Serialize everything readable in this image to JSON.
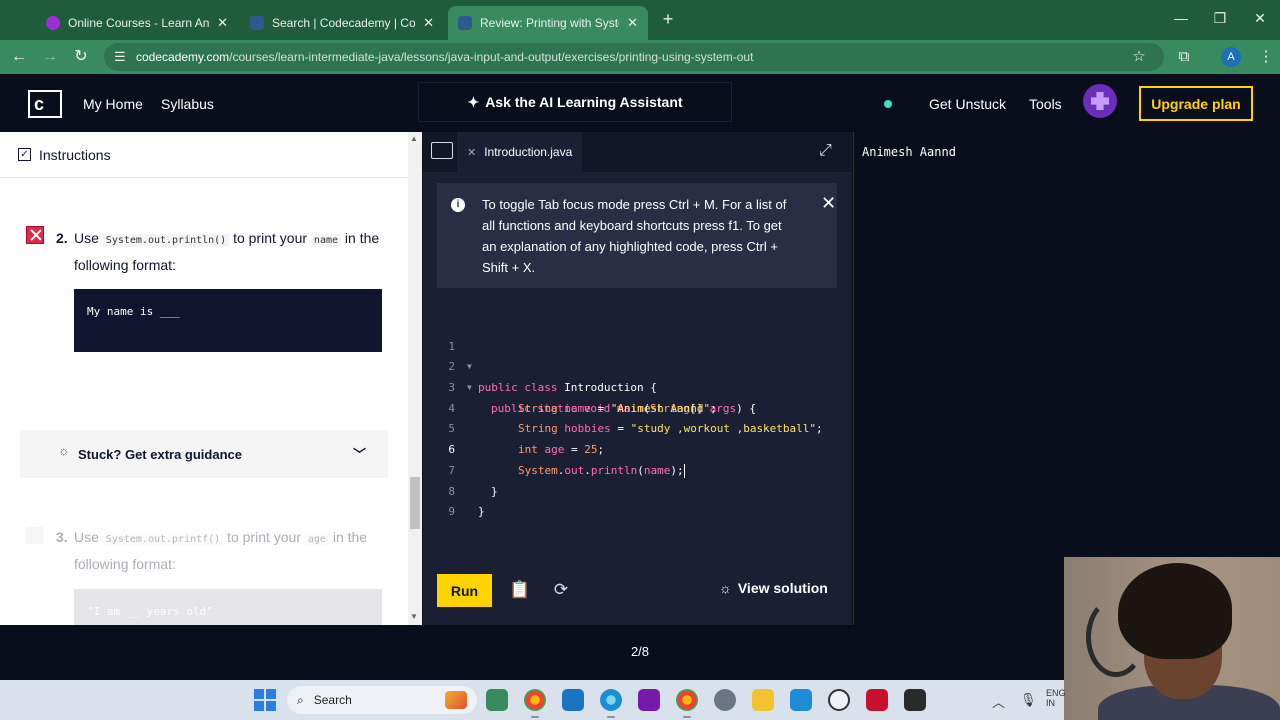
{
  "browser": {
    "tabs": [
      {
        "title": "Online Courses - Learn Anythin",
        "active": false
      },
      {
        "title": "Search | Codecademy | Codecad",
        "active": false
      },
      {
        "title": "Review: Printing with System.ou",
        "active": true
      }
    ],
    "new_tab_label": "+",
    "url_host": "codecademy.com",
    "url_path": "/courses/learn-intermediate-java/lessons/java-input-and-output/exercises/printing-using-system-out",
    "profile_initial": "A"
  },
  "header": {
    "nav": [
      "My Home",
      "Syllabus"
    ],
    "ask_ai_label": "Ask the AI Learning Assistant",
    "get_unstuck_label": "Get Unstuck",
    "tools_label": "Tools",
    "upgrade_label": "Upgrade plan",
    "logo_letter": "c"
  },
  "instructions": {
    "heading": "Instructions",
    "task2": {
      "number": "2.",
      "before": "Use ",
      "code1": "System.out.println()",
      "middle": " to print your ",
      "code2": "name",
      "after": " in the following format:",
      "example": "My name is ___",
      "status": "failed"
    },
    "stuck_label": "Stuck? Get extra guidance",
    "task3": {
      "number": "3.",
      "before": "Use ",
      "code1": "System.out.printf()",
      "middle": " to print your ",
      "code2": "age",
      "after": " in the following format:",
      "example": "\"I am __ years old\""
    }
  },
  "editor": {
    "tab_label": "Introduction.java",
    "toast": "To toggle Tab focus mode press Ctrl + M. For a list of all functions and keyboard shortcuts press f1. To get an explanation of any highlighted code, press Ctrl + Shift + X.",
    "line_numbers": [
      "1",
      "2",
      "3",
      "4",
      "5",
      "6",
      "7",
      "8",
      "9"
    ],
    "current_line": 6,
    "code_lines": [
      "public class Introduction {",
      "  public static void main(String[] args) {",
      "      String name = \"Animesh Aannd\";",
      "      String hobbies = \"study ,workout ,basketball\";",
      "      int age = 25;",
      "      System.out.println(name);",
      "  }",
      "}",
      ""
    ],
    "run_label": "Run",
    "view_solution_label": "View solution"
  },
  "output": {
    "text": "Animesh Aannd"
  },
  "pagination": "2/8",
  "taskbar": {
    "search_label": "Search",
    "lang_line1": "ENG",
    "lang_line2": "IN"
  },
  "colors": {
    "browser_frame": "#1f5c3c",
    "cc_navy": "#10162f",
    "cc_yellow": "#ffd300",
    "editor_bg": "#1b1f33"
  }
}
